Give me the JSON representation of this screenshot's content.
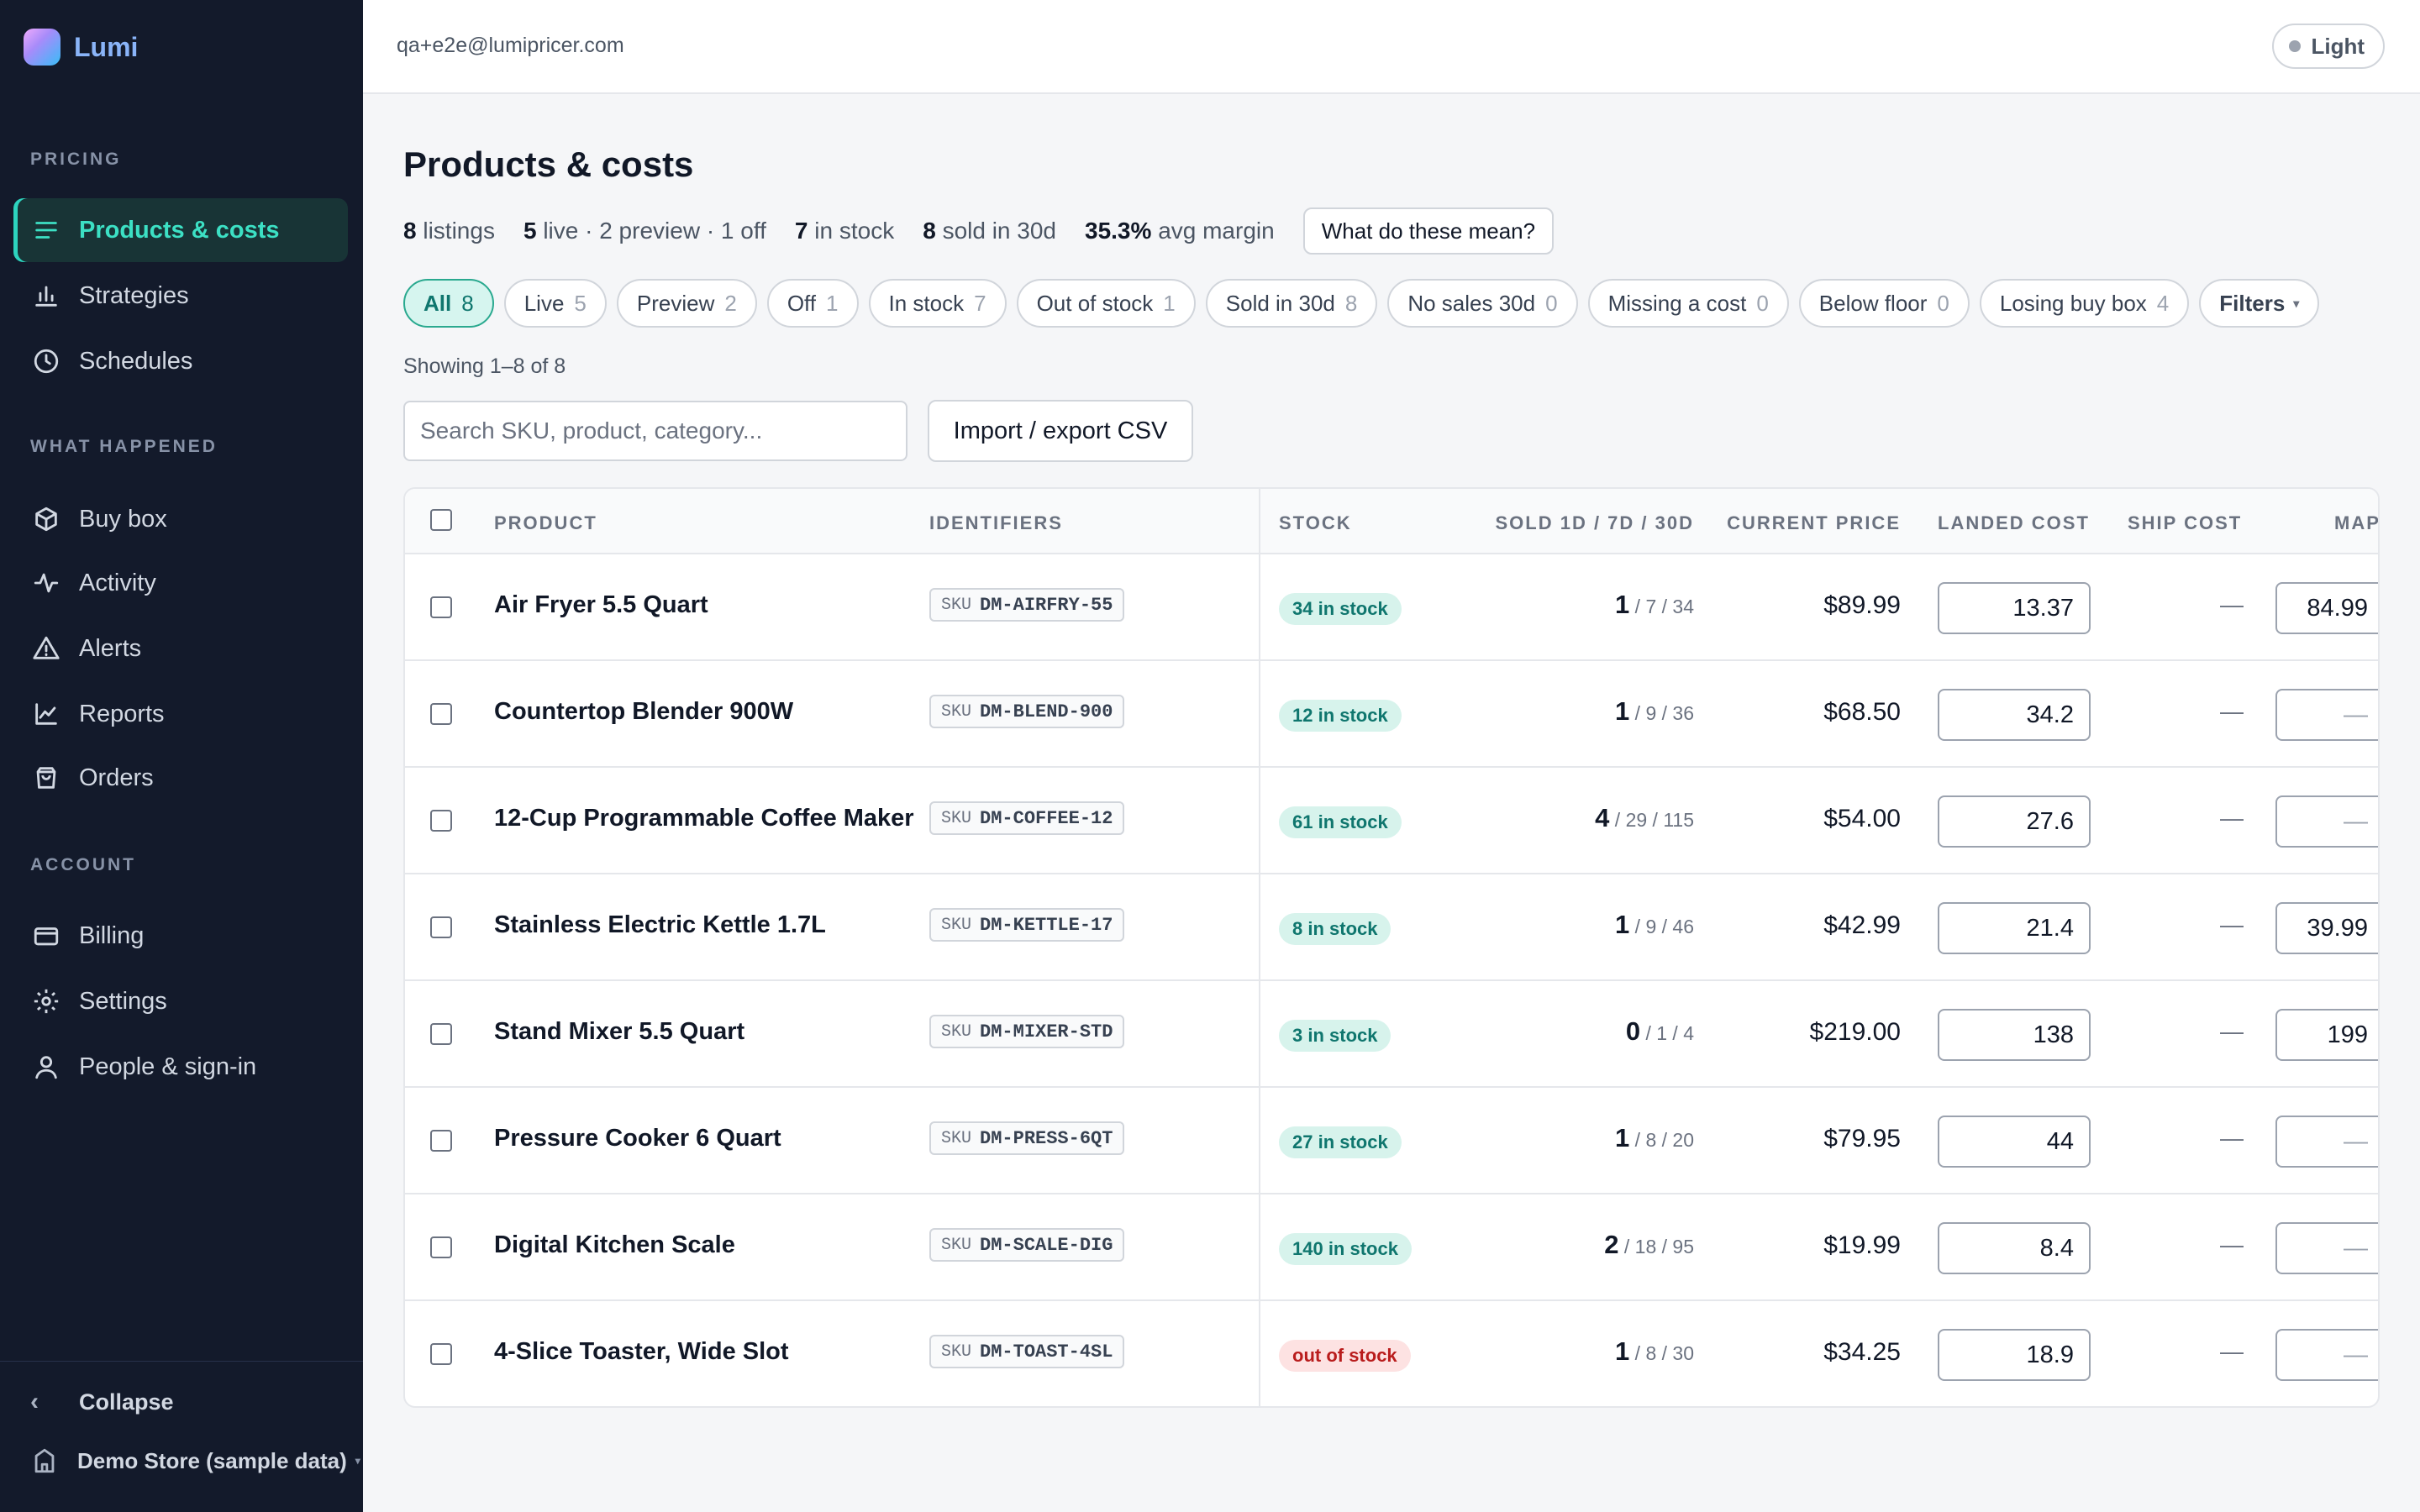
{
  "app": {
    "name": "Lumi",
    "user_email": "qa+e2e@lumipricer.com",
    "theme_label": "Light"
  },
  "sidebar": {
    "sections": [
      "PRICING",
      "WHAT HAPPENED",
      "ACCOUNT"
    ],
    "pricing": [
      {
        "label": "Products & costs",
        "icon": "list-icon",
        "active": true
      },
      {
        "label": "Strategies",
        "icon": "bar-chart-icon"
      },
      {
        "label": "Schedules",
        "icon": "clock-icon"
      }
    ],
    "what_happened": [
      {
        "label": "Buy box",
        "icon": "box-icon"
      },
      {
        "label": "Activity",
        "icon": "activity-icon"
      },
      {
        "label": "Alerts",
        "icon": "alert-triangle-icon"
      },
      {
        "label": "Reports",
        "icon": "line-chart-icon"
      },
      {
        "label": "Orders",
        "icon": "shopping-bag-icon"
      }
    ],
    "account": [
      {
        "label": "Billing",
        "icon": "credit-card-icon"
      },
      {
        "label": "Settings",
        "icon": "gear-icon"
      },
      {
        "label": "People & sign-in",
        "icon": "user-icon"
      }
    ],
    "collapse_label": "Collapse",
    "store_label": "Demo Store (sample data)"
  },
  "page": {
    "title": "Products & costs",
    "stats": {
      "listings_n": "8",
      "listings_label": "listings",
      "live_n": "5",
      "live_label": "live · 2 preview · 1 off",
      "stock_n": "7",
      "stock_label": "in stock",
      "sold_n": "8",
      "sold_label": "sold in 30d",
      "margin_n": "35.3%",
      "margin_label": "avg margin"
    },
    "help_button": "What do these mean?",
    "chips": [
      {
        "label": "All",
        "count": "8",
        "active": true
      },
      {
        "label": "Live",
        "count": "5"
      },
      {
        "label": "Preview",
        "count": "2"
      },
      {
        "label": "Off",
        "count": "1"
      },
      {
        "label": "In stock",
        "count": "7"
      },
      {
        "label": "Out of stock",
        "count": "1"
      },
      {
        "label": "Sold in 30d",
        "count": "8"
      },
      {
        "label": "No sales 30d",
        "count": "0"
      },
      {
        "label": "Missing a cost",
        "count": "0"
      },
      {
        "label": "Below floor",
        "count": "0"
      },
      {
        "label": "Losing buy box",
        "count": "4"
      }
    ],
    "filters_label": "Filters",
    "showing": "Showing 1–8 of 8",
    "search_placeholder": "Search SKU, product, category...",
    "csv_button": "Import / export CSV"
  },
  "table": {
    "headers": {
      "product": "PRODUCT",
      "identifiers": "IDENTIFIERS",
      "stock": "STOCK",
      "sold": "SOLD 1D / 7D / 30D",
      "price": "CURRENT PRICE",
      "landed": "LANDED COST",
      "ship": "SHIP COST",
      "map": "MAP"
    },
    "sku_prefix": "SKU",
    "rows": [
      {
        "name": "Air Fryer 5.5 Quart",
        "sku": "DM-AIRFRY-55",
        "stock": "34 in stock",
        "in_stock": true,
        "d1": "1",
        "rest": " / 7 / 34",
        "price": "$89.99",
        "landed": "13.37",
        "ship": "—",
        "map": "84.99"
      },
      {
        "name": "Countertop Blender 900W",
        "sku": "DM-BLEND-900",
        "stock": "12 in stock",
        "in_stock": true,
        "d1": "1",
        "rest": " / 9 / 36",
        "price": "$68.50",
        "landed": "34.2",
        "ship": "—",
        "map": "—"
      },
      {
        "name": "12-Cup Programmable Coffee Maker",
        "sku": "DM-COFFEE-12",
        "stock": "61 in stock",
        "in_stock": true,
        "d1": "4",
        "rest": " / 29 / 115",
        "price": "$54.00",
        "landed": "27.6",
        "ship": "—",
        "map": "—"
      },
      {
        "name": "Stainless Electric Kettle 1.7L",
        "sku": "DM-KETTLE-17",
        "stock": "8 in stock",
        "in_stock": true,
        "d1": "1",
        "rest": " / 9 / 46",
        "price": "$42.99",
        "landed": "21.4",
        "ship": "—",
        "map": "39.99"
      },
      {
        "name": "Stand Mixer 5.5 Quart",
        "sku": "DM-MIXER-STD",
        "stock": "3 in stock",
        "in_stock": true,
        "d1": "0",
        "rest": " / 1 / 4",
        "price": "$219.00",
        "landed": "138",
        "ship": "—",
        "map": "199"
      },
      {
        "name": "Pressure Cooker 6 Quart",
        "sku": "DM-PRESS-6QT",
        "stock": "27 in stock",
        "in_stock": true,
        "d1": "1",
        "rest": " / 8 / 20",
        "price": "$79.95",
        "landed": "44",
        "ship": "—",
        "map": "—"
      },
      {
        "name": "Digital Kitchen Scale",
        "sku": "DM-SCALE-DIG",
        "stock": "140 in stock",
        "in_stock": true,
        "d1": "2",
        "rest": " / 18 / 95",
        "price": "$19.99",
        "landed": "8.4",
        "ship": "—",
        "map": "—"
      },
      {
        "name": "4-Slice Toaster, Wide Slot",
        "sku": "DM-TOAST-4SL",
        "stock": "out of stock",
        "in_stock": false,
        "d1": "1",
        "rest": " / 8 / 30",
        "price": "$34.25",
        "landed": "18.9",
        "ship": "—",
        "map": "—"
      }
    ]
  },
  "colors": {
    "sidebar_bg": "#131a2b",
    "accent": "#2dd4bf",
    "in_stock": "#0f766e",
    "out_of_stock": "#b91c1c"
  }
}
